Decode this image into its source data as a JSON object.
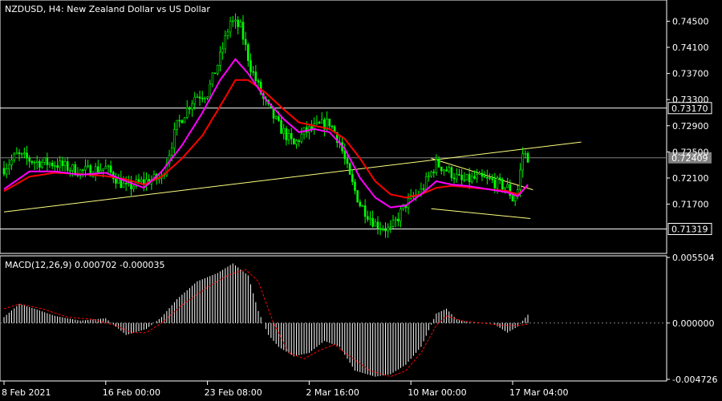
{
  "chart_data": {
    "type": "candlestick",
    "title": "NZDUSD, H4:  New Zealand Dollar vs US Dollar",
    "symbol": "NZDUSD",
    "timeframe": "H4",
    "colors": {
      "background": "#000000",
      "axis": "#ffffff",
      "candle": "#00ff00",
      "ma_fast": "#ff00ff",
      "ma_slow": "#ff0000",
      "trendline": "#ffff7f",
      "hline": "#ffffff",
      "macd_hist": "#ffffff",
      "macd_signal": "#ff0000",
      "badge_bg": "#808080"
    },
    "price_axis": {
      "ylim": [
        0.7097,
        0.748
      ],
      "ticks": [
        "0.74500",
        "0.74100",
        "0.73700",
        "0.73300",
        "0.72900",
        "0.72500",
        "0.72100",
        "0.71700"
      ]
    },
    "time_axis": {
      "labels": [
        "8 Feb 2021",
        "16 Feb 00:00",
        "23 Feb 08:00",
        "2 Mar 16:00",
        "10 Mar 00:00",
        "17 Mar 04:00"
      ],
      "label_bars": [
        0,
        40,
        80,
        120,
        160,
        200
      ]
    },
    "horizontal_lines": [
      {
        "price": 0.7317,
        "label": "0.73170"
      },
      {
        "price": 0.7132,
        "label": "0.71319"
      }
    ],
    "current_price": {
      "price": 0.72409,
      "label": "0.72409"
    },
    "trendlines": [
      {
        "from": [
          0,
          0.7158
        ],
        "to": [
          227,
          0.7265
        ]
      },
      {
        "from": [
          168,
          0.724
        ],
        "to": [
          208,
          0.7192
        ]
      },
      {
        "from": [
          168,
          0.7163
        ],
        "to": [
          207,
          0.7148
        ]
      }
    ],
    "anchors": [
      [
        0,
        0.7225
      ],
      [
        5,
        0.7245
      ],
      [
        12,
        0.7235
      ],
      [
        20,
        0.7232
      ],
      [
        30,
        0.722
      ],
      [
        40,
        0.7225
      ],
      [
        48,
        0.7195
      ],
      [
        55,
        0.7205
      ],
      [
        62,
        0.721
      ],
      [
        68,
        0.729
      ],
      [
        75,
        0.7335
      ],
      [
        80,
        0.734
      ],
      [
        85,
        0.7395
      ],
      [
        89,
        0.745
      ],
      [
        93,
        0.744
      ],
      [
        97,
        0.738
      ],
      [
        102,
        0.733
      ],
      [
        108,
        0.729
      ],
      [
        114,
        0.726
      ],
      [
        118,
        0.728
      ],
      [
        124,
        0.729
      ],
      [
        128,
        0.7295
      ],
      [
        132,
        0.7265
      ],
      [
        136,
        0.721
      ],
      [
        140,
        0.717
      ],
      [
        146,
        0.714
      ],
      [
        152,
        0.713
      ],
      [
        158,
        0.717
      ],
      [
        164,
        0.719
      ],
      [
        170,
        0.7232
      ],
      [
        175,
        0.722
      ],
      [
        180,
        0.7205
      ],
      [
        186,
        0.721
      ],
      [
        192,
        0.7205
      ],
      [
        198,
        0.7195
      ],
      [
        200,
        0.7178
      ],
      [
        202,
        0.7192
      ],
      [
        204,
        0.7248
      ],
      [
        206,
        0.7242
      ]
    ],
    "ma_fast": [
      [
        0,
        0.7193
      ],
      [
        10,
        0.722
      ],
      [
        20,
        0.722
      ],
      [
        30,
        0.7215
      ],
      [
        40,
        0.7218
      ],
      [
        48,
        0.7205
      ],
      [
        55,
        0.7195
      ],
      [
        62,
        0.722
      ],
      [
        70,
        0.726
      ],
      [
        78,
        0.731
      ],
      [
        85,
        0.736
      ],
      [
        91,
        0.7392
      ],
      [
        96,
        0.737
      ],
      [
        103,
        0.733
      ],
      [
        110,
        0.73
      ],
      [
        116,
        0.728
      ],
      [
        122,
        0.7285
      ],
      [
        128,
        0.728
      ],
      [
        134,
        0.7255
      ],
      [
        140,
        0.721
      ],
      [
        146,
        0.718
      ],
      [
        152,
        0.7165
      ],
      [
        158,
        0.7168
      ],
      [
        164,
        0.7185
      ],
      [
        170,
        0.7205
      ],
      [
        176,
        0.72
      ],
      [
        182,
        0.7198
      ],
      [
        190,
        0.7193
      ],
      [
        198,
        0.7188
      ],
      [
        202,
        0.7182
      ],
      [
        206,
        0.72
      ]
    ],
    "ma_slow": [
      [
        0,
        0.719
      ],
      [
        10,
        0.7212
      ],
      [
        20,
        0.7218
      ],
      [
        30,
        0.7216
      ],
      [
        40,
        0.7213
      ],
      [
        48,
        0.7208
      ],
      [
        55,
        0.72
      ],
      [
        62,
        0.7212
      ],
      [
        70,
        0.724
      ],
      [
        78,
        0.7275
      ],
      [
        85,
        0.732
      ],
      [
        91,
        0.736
      ],
      [
        96,
        0.736
      ],
      [
        103,
        0.734
      ],
      [
        110,
        0.7315
      ],
      [
        116,
        0.7295
      ],
      [
        122,
        0.729
      ],
      [
        128,
        0.7285
      ],
      [
        134,
        0.727
      ],
      [
        140,
        0.724
      ],
      [
        146,
        0.7205
      ],
      [
        152,
        0.7185
      ],
      [
        158,
        0.718
      ],
      [
        164,
        0.7185
      ],
      [
        170,
        0.7195
      ],
      [
        176,
        0.7198
      ],
      [
        182,
        0.7196
      ],
      [
        190,
        0.7193
      ],
      [
        198,
        0.719
      ],
      [
        202,
        0.7185
      ],
      [
        206,
        0.7198
      ]
    ],
    "macd": {
      "label": "MACD(12,26,9) 0.000702 -0.000035",
      "ylim": [
        -0.004726,
        0.005504
      ],
      "ticks": [
        "0.005504",
        "0.000000",
        "-0.004726"
      ],
      "hist_anchors": [
        [
          0,
          0.0005
        ],
        [
          6,
          0.0016
        ],
        [
          12,
          0.0012
        ],
        [
          20,
          0.0006
        ],
        [
          30,
          0.0002
        ],
        [
          40,
          0.0004
        ],
        [
          48,
          -0.001
        ],
        [
          56,
          -0.0005
        ],
        [
          62,
          0.0005
        ],
        [
          68,
          0.002
        ],
        [
          76,
          0.0035
        ],
        [
          84,
          0.0042
        ],
        [
          90,
          0.005
        ],
        [
          96,
          0.004
        ],
        [
          100,
          0.001
        ],
        [
          104,
          -0.001
        ],
        [
          108,
          -0.002
        ],
        [
          114,
          -0.0028
        ],
        [
          120,
          -0.0025
        ],
        [
          126,
          -0.0015
        ],
        [
          132,
          -0.002
        ],
        [
          138,
          -0.004
        ],
        [
          146,
          -0.0045
        ],
        [
          152,
          -0.0043
        ],
        [
          158,
          -0.0035
        ],
        [
          164,
          -0.002
        ],
        [
          170,
          0.0008
        ],
        [
          174,
          0.0012
        ],
        [
          178,
          0.0003
        ],
        [
          184,
          0.0
        ],
        [
          192,
          0.0
        ],
        [
          198,
          -0.0008
        ],
        [
          202,
          -0.0003
        ],
        [
          206,
          0.0007
        ]
      ],
      "signal_anchors": [
        [
          0,
          0.0012
        ],
        [
          6,
          0.0016
        ],
        [
          15,
          0.0012
        ],
        [
          25,
          0.0005
        ],
        [
          35,
          0.0003
        ],
        [
          44,
          -0.0002
        ],
        [
          50,
          -0.0008
        ],
        [
          56,
          -0.0008
        ],
        [
          62,
          0.0
        ],
        [
          70,
          0.0015
        ],
        [
          80,
          0.003
        ],
        [
          88,
          0.004
        ],
        [
          95,
          0.0045
        ],
        [
          100,
          0.0035
        ],
        [
          106,
          0.0
        ],
        [
          112,
          -0.0025
        ],
        [
          118,
          -0.003
        ],
        [
          124,
          -0.0023
        ],
        [
          130,
          -0.0018
        ],
        [
          136,
          -0.0028
        ],
        [
          144,
          -0.004
        ],
        [
          152,
          -0.0045
        ],
        [
          158,
          -0.004
        ],
        [
          164,
          -0.0025
        ],
        [
          170,
          -0.0002
        ],
        [
          174,
          0.0006
        ],
        [
          180,
          0.0002
        ],
        [
          188,
          0.0
        ],
        [
          196,
          -0.0002
        ],
        [
          202,
          -0.0002
        ],
        [
          206,
          -0.0001
        ]
      ]
    }
  }
}
